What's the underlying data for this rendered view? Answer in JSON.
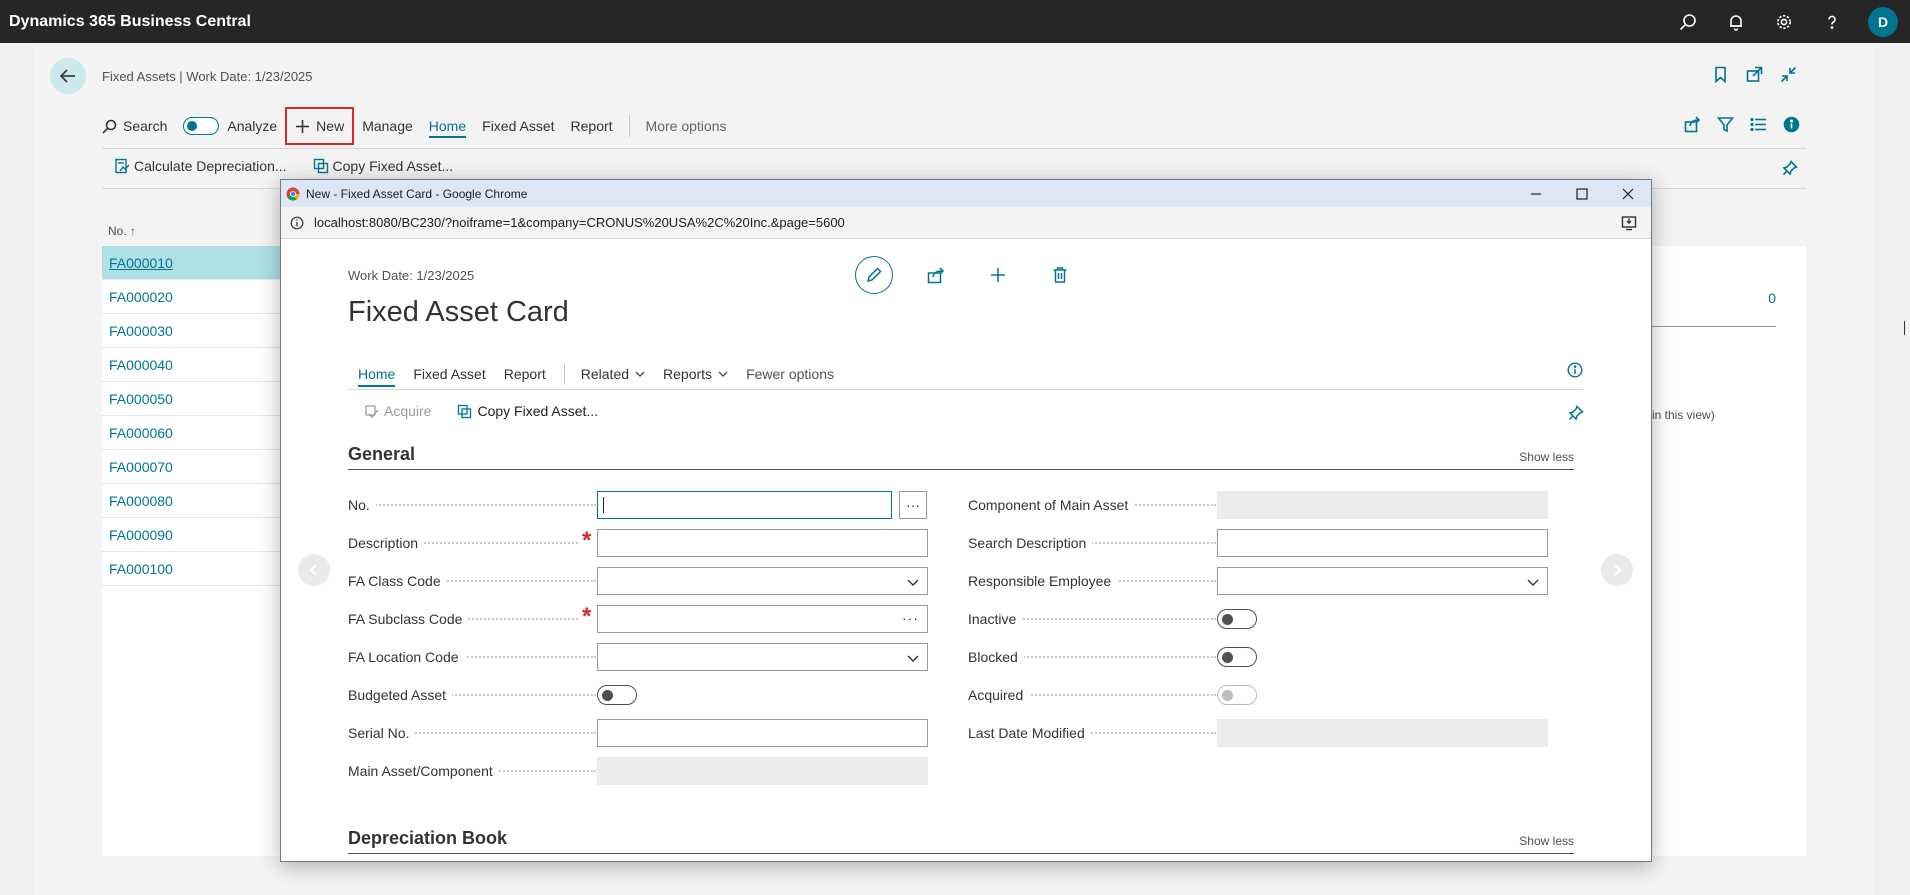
{
  "app": {
    "title": "Dynamics 365 Business Central",
    "avatar_initial": "D"
  },
  "background": {
    "breadcrumb": "Fixed Assets | Work Date: 1/23/2025",
    "actions": {
      "search": "Search",
      "analyze": "Analyze",
      "new": "New",
      "manage": "Manage",
      "home": "Home",
      "fixed_asset": "Fixed Asset",
      "report": "Report",
      "more_options": "More options"
    },
    "sub_actions": {
      "calculate_depreciation": "Calculate Depreciation...",
      "copy_fixed_asset": "Copy Fixed Asset..."
    },
    "list": {
      "column_no": "No.",
      "sort_indicator": "↑",
      "rows": [
        "FA000010",
        "FA000020",
        "FA000030",
        "FA000040",
        "FA000050",
        "FA000060",
        "FA000070",
        "FA000080",
        "FA000090",
        "FA000100"
      ]
    },
    "factbox": {
      "value": "0",
      "note": "in this view)"
    }
  },
  "window": {
    "title": "New - Fixed Asset Card - Google Chrome",
    "url": "localhost:8080/BC230/?noiframe=1&company=CRONUS%20USA%2C%20Inc.&page=5600"
  },
  "card": {
    "work_date": "Work Date: 1/23/2025",
    "title": "Fixed Asset Card",
    "actions": {
      "home": "Home",
      "fixed_asset": "Fixed Asset",
      "report": "Report",
      "related": "Related",
      "reports": "Reports",
      "fewer_options": "Fewer options"
    },
    "sub_actions": {
      "acquire": "Acquire",
      "copy_fixed_asset": "Copy Fixed Asset..."
    },
    "general": {
      "title": "General",
      "show_less": "Show less",
      "left_fields": {
        "no": "No.",
        "description": "Description",
        "fa_class_code": "FA Class Code",
        "fa_subclass_code": "FA Subclass Code",
        "fa_location_code": "FA Location Code",
        "budgeted_asset": "Budgeted Asset",
        "serial_no": "Serial No.",
        "main_asset_component": "Main Asset/Component"
      },
      "right_fields": {
        "component_of_main_asset": "Component of Main Asset",
        "search_description": "Search Description",
        "responsible_employee": "Responsible Employee",
        "inactive": "Inactive",
        "blocked": "Blocked",
        "acquired": "Acquired",
        "last_date_modified": "Last Date Modified"
      },
      "values": {
        "no": "",
        "description": "",
        "search_description": "",
        "serial_no": ""
      },
      "required_mark": "*",
      "ellipsis": "···"
    },
    "depreciation_book": {
      "title": "Depreciation Book",
      "show_less": "Show less"
    }
  },
  "colors": {
    "accent": "#00758f",
    "required": "#d62929",
    "highlight_border": "#d62929",
    "topbar": "#262626"
  }
}
